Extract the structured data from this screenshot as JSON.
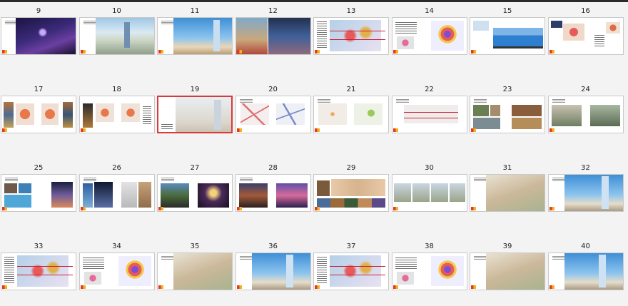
{
  "window": {
    "title": ""
  },
  "pages": [
    {
      "num": "9"
    },
    {
      "num": "10"
    },
    {
      "num": "11"
    },
    {
      "num": "12"
    },
    {
      "num": "13"
    },
    {
      "num": "14"
    },
    {
      "num": "15"
    },
    {
      "num": "16"
    },
    {
      "num": "17"
    },
    {
      "num": "18"
    },
    {
      "num": "19",
      "selected": true
    },
    {
      "num": "20"
    },
    {
      "num": "21"
    },
    {
      "num": "22"
    },
    {
      "num": "23"
    },
    {
      "num": "24"
    },
    {
      "num": "25"
    },
    {
      "num": "26"
    },
    {
      "num": "27"
    },
    {
      "num": "28"
    },
    {
      "num": "29"
    },
    {
      "num": "30"
    },
    {
      "num": "31"
    },
    {
      "num": "32"
    },
    {
      "num": "33"
    },
    {
      "num": "34"
    },
    {
      "num": "35"
    },
    {
      "num": "36"
    },
    {
      "num": "37"
    },
    {
      "num": "38"
    },
    {
      "num": "39"
    },
    {
      "num": "40"
    }
  ],
  "colors": {
    "selection": "#d93b3b",
    "background": "#f3f3f3",
    "brand_red": "#e23a24",
    "brand_yellow": "#f2b21a"
  }
}
